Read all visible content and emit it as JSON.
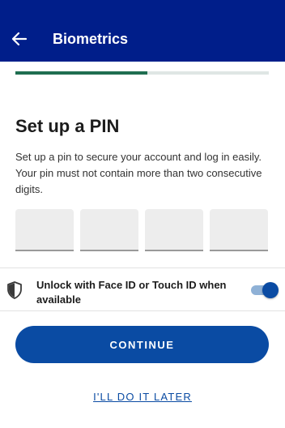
{
  "header": {
    "title": "Biometrics",
    "back_icon": "arrow-left-icon",
    "background": "#001e8a"
  },
  "progress": {
    "fraction": 0.52,
    "fill_color": "#1f6e50",
    "track_color": "#dfe6e4"
  },
  "main": {
    "heading": "Set up a PIN",
    "description": "Set up a pin to secure your account and log in easily. Your pin must not contain more than two consecutive digits.",
    "pin_digits": [
      "",
      "",
      "",
      ""
    ]
  },
  "biometric_toggle": {
    "label": "Unlock with Face ID or Touch ID when available",
    "icon": "shield-icon",
    "enabled": true
  },
  "actions": {
    "continue_label": "CONTINUE",
    "later_label": "I'LL DO IT LATER",
    "accent": "#0a4ba3"
  }
}
